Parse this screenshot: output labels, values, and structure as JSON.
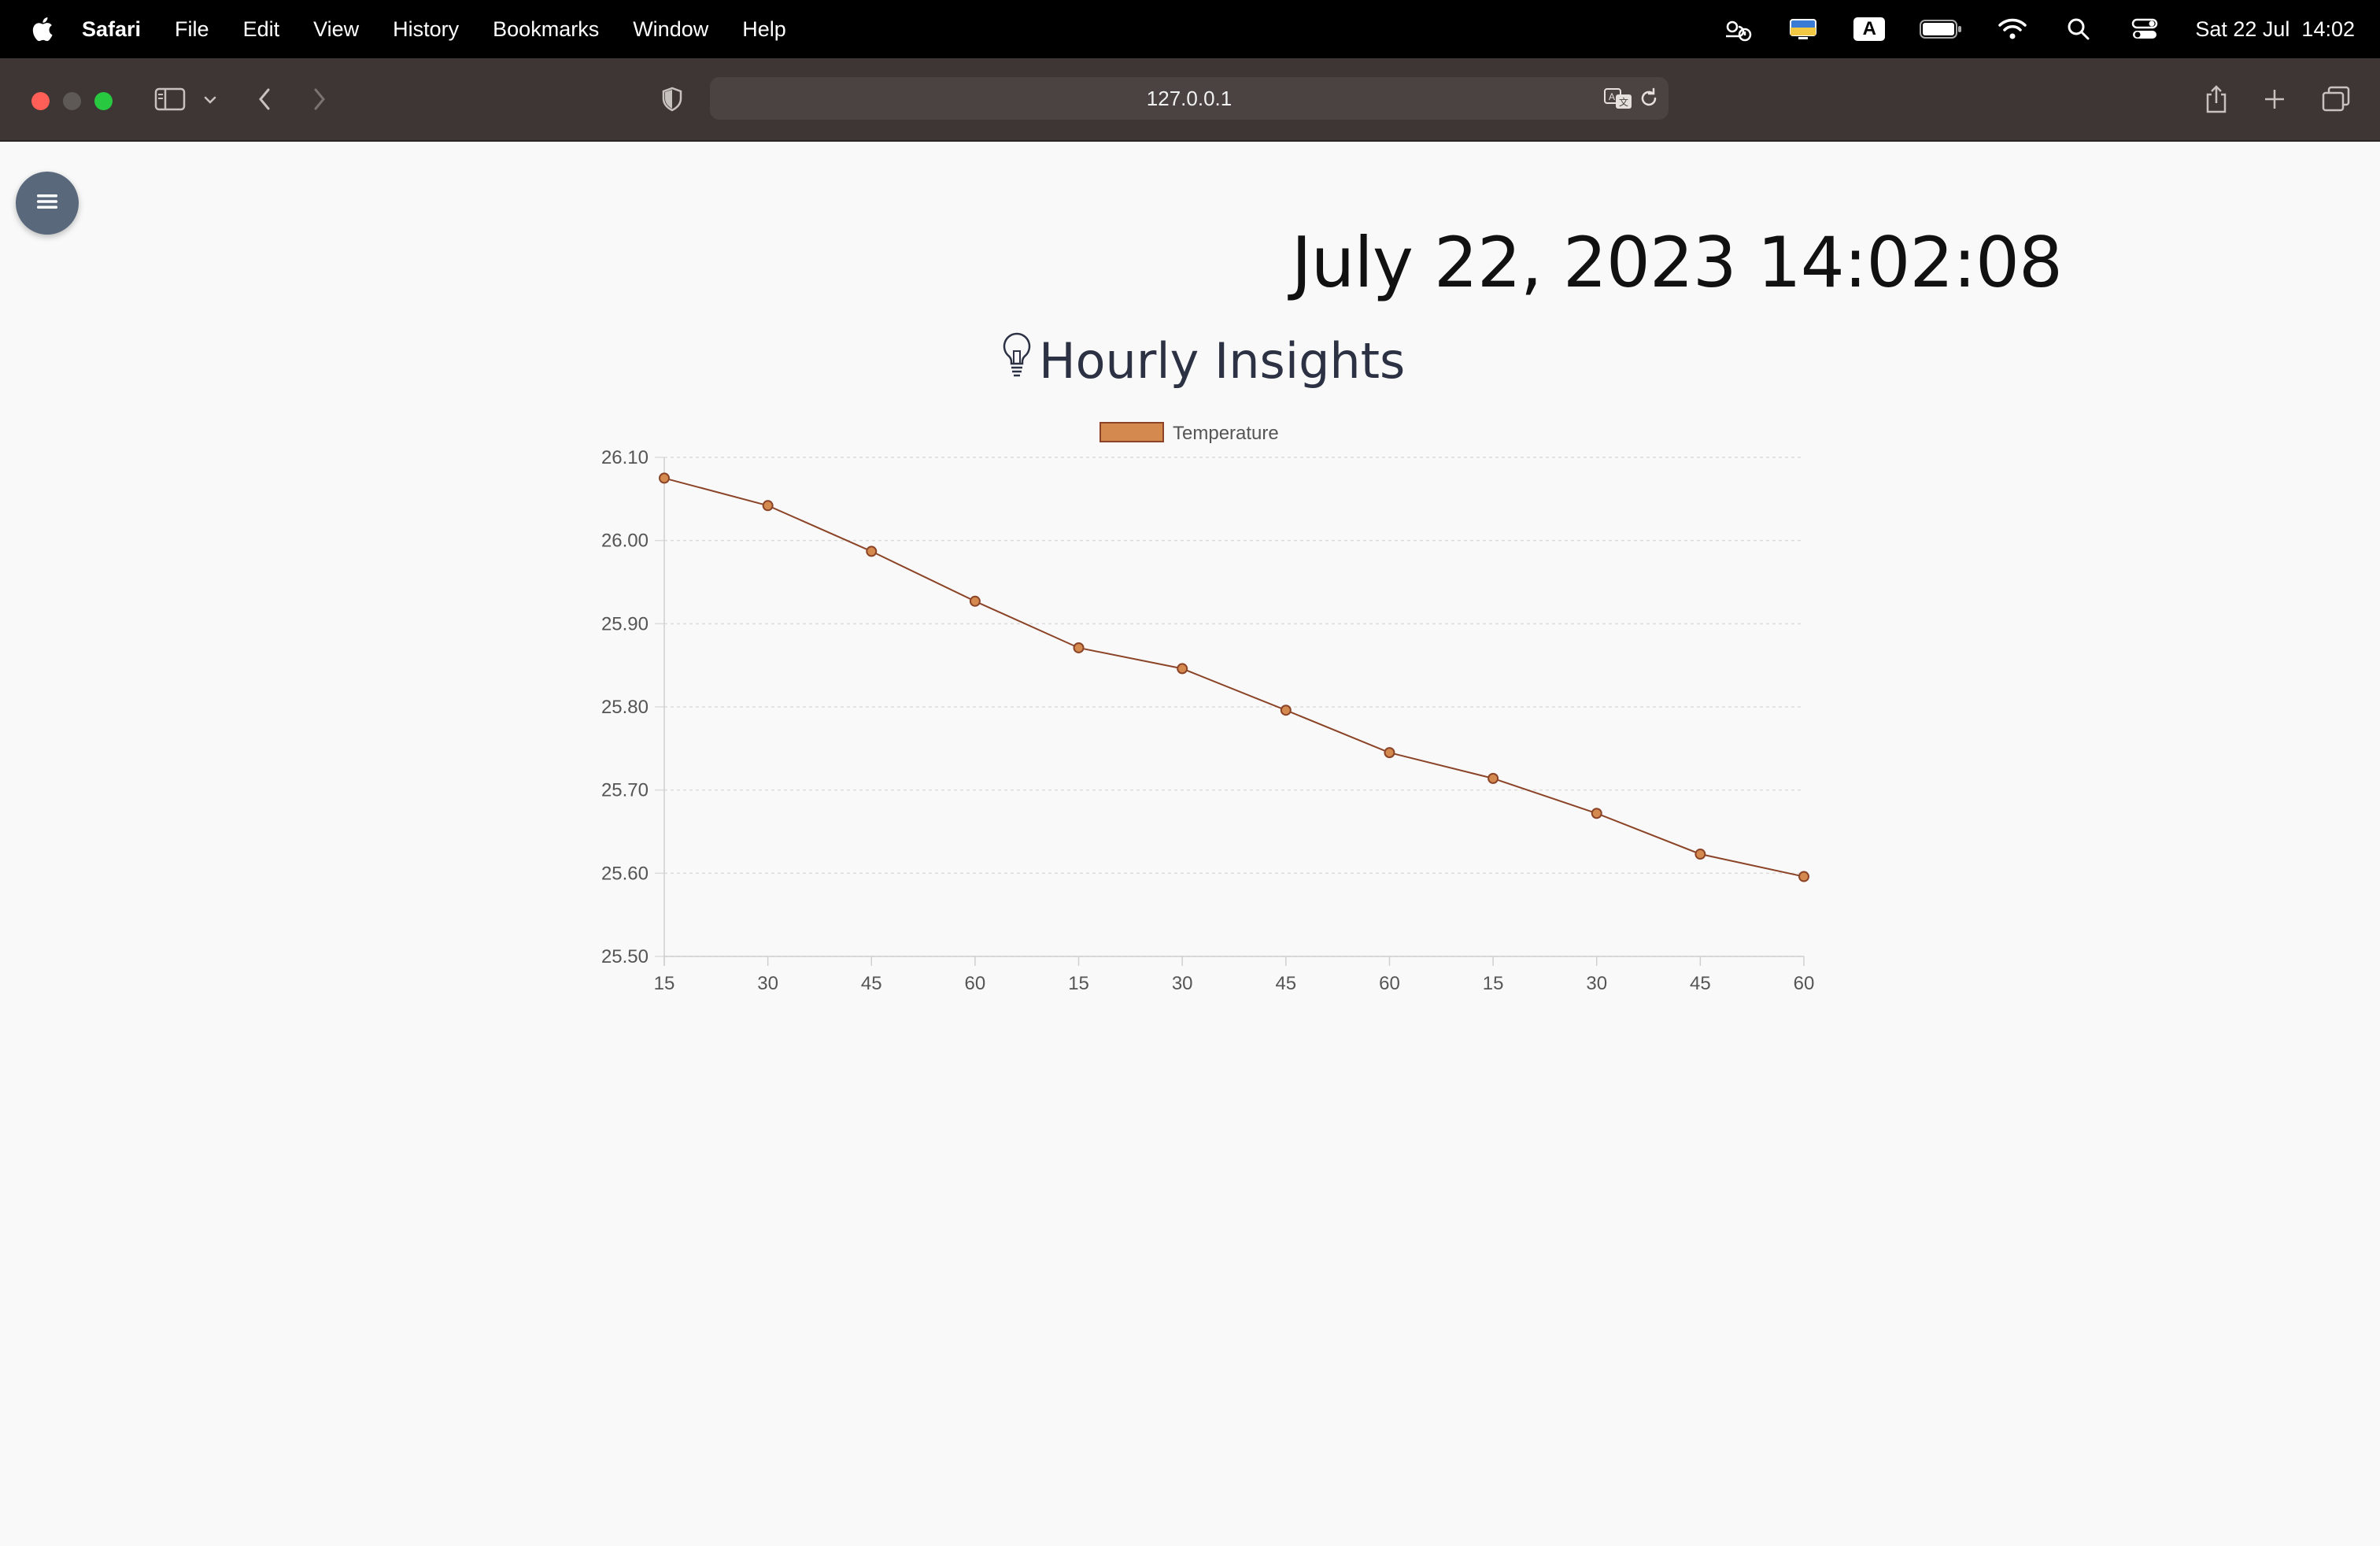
{
  "menubar": {
    "app_name": "Safari",
    "items": [
      "File",
      "Edit",
      "View",
      "History",
      "Bookmarks",
      "Window",
      "Help"
    ],
    "datetime": "Sat 22 Jul  14:02",
    "keyboard_indicator": "A"
  },
  "browser": {
    "url": "127.0.0.1"
  },
  "page": {
    "clock": "July 22, 2023 14:02:08",
    "title": "Hourly Insights"
  },
  "chart_data": {
    "type": "line",
    "categories": [
      "15",
      "30",
      "45",
      "60",
      "15",
      "30",
      "45",
      "60",
      "15",
      "30",
      "45",
      "60"
    ],
    "series": [
      {
        "name": "Temperature",
        "values": [
          26.075,
          26.042,
          25.987,
          25.927,
          25.871,
          25.846,
          25.796,
          25.745,
          25.714,
          25.672,
          25.623,
          25.596
        ]
      }
    ],
    "yticks": [
      "26.10",
      "26.00",
      "25.90",
      "25.80",
      "25.70",
      "25.60",
      "25.50"
    ],
    "ylim": [
      25.5,
      26.1
    ],
    "grid": true,
    "legend": "top-center",
    "colors": {
      "line": "#8b4427",
      "fill": "#d4894f"
    }
  }
}
